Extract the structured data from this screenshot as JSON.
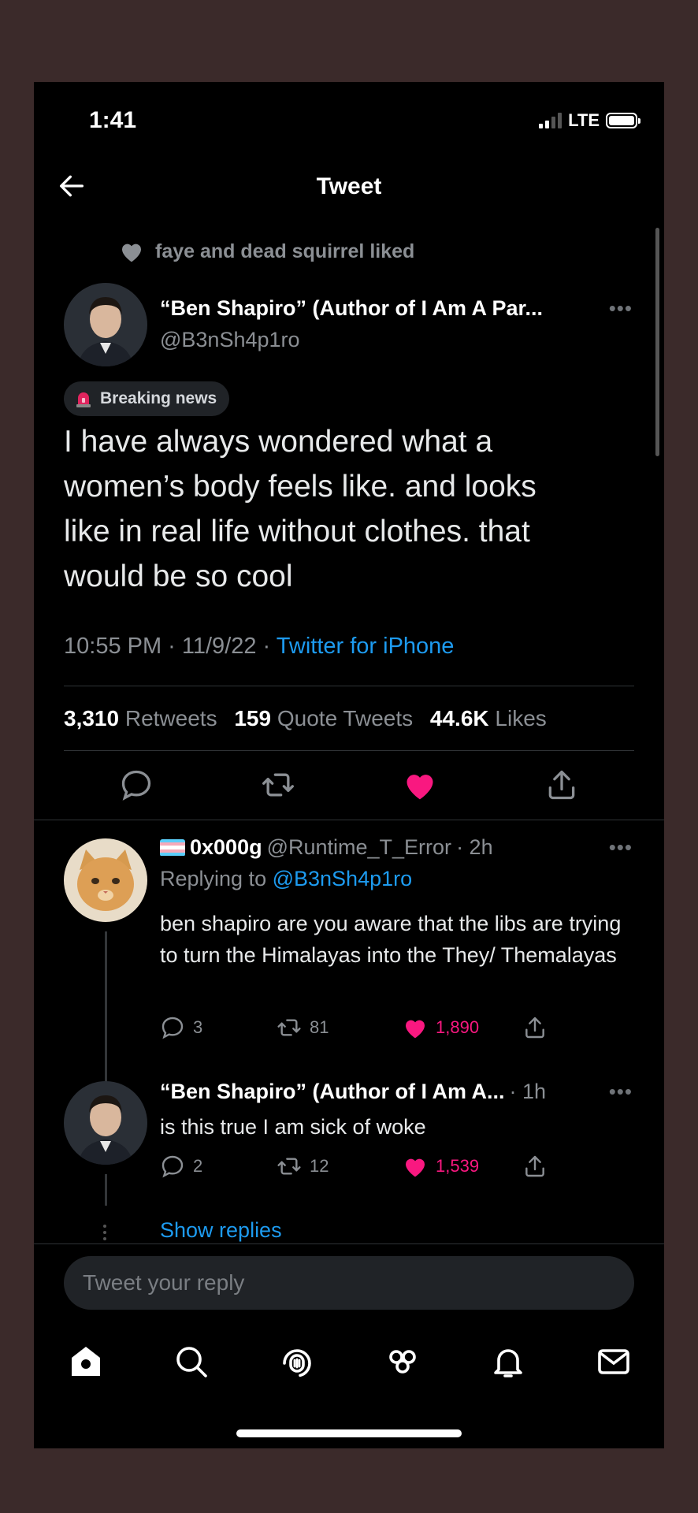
{
  "status": {
    "time": "1:41",
    "network": "LTE"
  },
  "header": {
    "title": "Tweet"
  },
  "social_context": {
    "text": "faye and dead squirrel liked"
  },
  "tweet": {
    "author_name": "“Ben Shapiro” (Author of I Am A Par...",
    "handle": "@B3nSh4p1ro",
    "badge": "Breaking news",
    "text": "I have  always wondered what a\nwomen’s body feels like. and looks\nlike in real life without clothes. that\nwould  be so cool",
    "time": "10:55 PM · 11/9/22 · ",
    "source": "Twitter for iPhone",
    "retweets_count": "3,310",
    "retweets_label": "Retweets",
    "quotes_count": "159",
    "quotes_label": "Quote Tweets",
    "likes_count": "44.6K",
    "likes_label": "Likes"
  },
  "replies": [
    {
      "name": "0x000g",
      "handle": "@Runtime_T_Error",
      "time": "· 2h",
      "replying_label": "Replying to ",
      "replying_to": "@B3nSh4p1ro",
      "text": "ben shapiro are you aware that the libs are trying to turn the Himalayas into the They/ Themalayas",
      "reply_count": "3",
      "retweet_count": "81",
      "like_count": "1,890"
    },
    {
      "name": "“Ben Shapiro” (Author of I Am A...",
      "handle": "",
      "time": "· 1h",
      "text": "is this true I am sick of woke",
      "reply_count": "2",
      "retweet_count": "12",
      "like_count": "1,539"
    }
  ],
  "show_replies": "Show replies",
  "reply_bar": {
    "placeholder": "Tweet your reply"
  },
  "tabbar": [
    "home-icon",
    "search-icon",
    "spaces-icon",
    "communities-icon",
    "notifications-icon",
    "messages-icon"
  ],
  "colors": {
    "accent": "#1d9bf0",
    "like": "#f91880",
    "background": "#000000"
  }
}
